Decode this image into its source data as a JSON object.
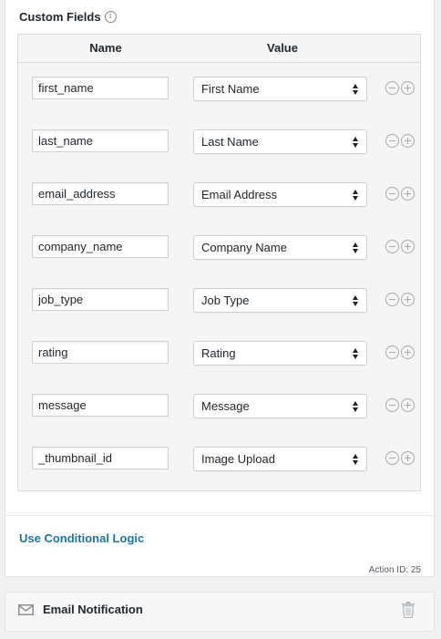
{
  "custom_fields": {
    "title": "Custom Fields",
    "info_icon": "i",
    "columns": {
      "name": "Name",
      "value": "Value"
    },
    "rows": [
      {
        "name": "first_name",
        "value": "First Name"
      },
      {
        "name": "last_name",
        "value": "Last Name"
      },
      {
        "name": "email_address",
        "value": "Email Address"
      },
      {
        "name": "company_name",
        "value": "Company Name"
      },
      {
        "name": "job_type",
        "value": "Job Type"
      },
      {
        "name": "rating",
        "value": "Rating"
      },
      {
        "name": "message",
        "value": "Message"
      },
      {
        "name": "_thumbnail_id",
        "value": "Image Upload"
      }
    ]
  },
  "conditional_logic": {
    "label": "Use Conditional Logic"
  },
  "action_id": {
    "text": "Action ID: 25"
  },
  "email_notification": {
    "title": "Email Notification"
  },
  "icons": {
    "info": "info-icon",
    "remove": "minus-circle-icon",
    "add": "plus-circle-icon",
    "select": "select-arrows-icon",
    "notification": "envelope-icon",
    "delete": "trash-icon"
  },
  "colors": {
    "link": "#21759b",
    "text": "#23282d",
    "panel_bg": "#ffffff",
    "fields_bg": "#f5f5f5"
  }
}
